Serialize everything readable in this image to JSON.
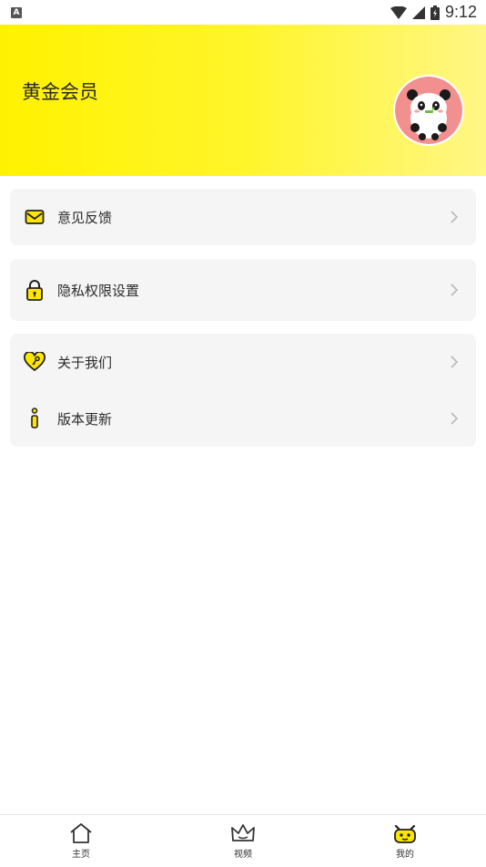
{
  "status_bar": {
    "app_icon_letter": "A",
    "time": "9:12"
  },
  "header": {
    "title": "黄金会员"
  },
  "menu": {
    "feedback": {
      "label": "意见反馈",
      "icon": "mail-icon"
    },
    "privacy": {
      "label": "隐私权限设置",
      "icon": "lock-icon"
    },
    "about": {
      "label": "关于我们",
      "icon": "heart-key-icon"
    },
    "update": {
      "label": "版本更新",
      "icon": "info-icon"
    }
  },
  "tabs": [
    {
      "label": "主页",
      "icon": "home-icon"
    },
    {
      "label": "视频",
      "icon": "crown-icon"
    },
    {
      "label": "我的",
      "icon": "profile-icon",
      "active": true
    }
  ],
  "colors": {
    "accent": "#ffe600",
    "header_gradient_start": "#fff200",
    "header_gradient_end": "#fff686",
    "card_bg": "#f5f5f5"
  }
}
